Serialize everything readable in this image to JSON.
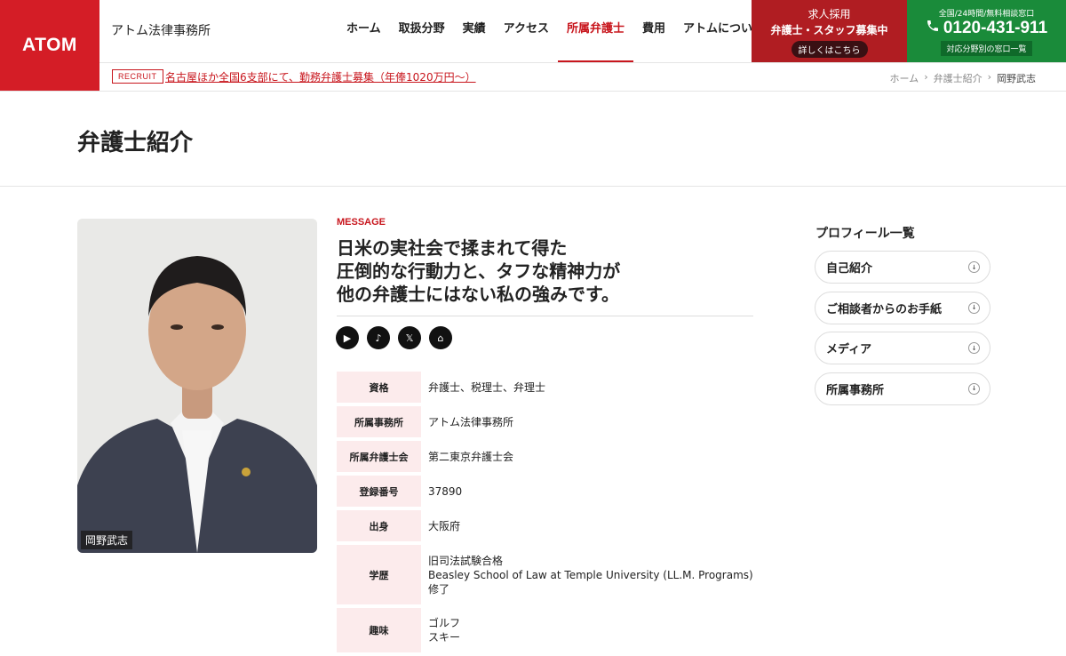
{
  "header": {
    "logo": "ATOM",
    "firm_name": "アトム法律事務所",
    "nav": [
      {
        "label": "ホーム"
      },
      {
        "label": "取扱分野"
      },
      {
        "label": "実績"
      },
      {
        "label": "アクセス"
      },
      {
        "label": "所属弁護士"
      },
      {
        "label": "費用"
      },
      {
        "label": "アトムについて"
      }
    ],
    "recruit_box": {
      "line1": "求人採用",
      "line2": "弁護士・スタッフ募集中",
      "button": "詳しくはこちら"
    },
    "phone_box": {
      "line1": "全国/24時間/無料相談窓口",
      "number": "0120-431-911",
      "sub": "対応分野別の窓口一覧"
    },
    "subbar": {
      "tag": "RECRUIT",
      "link": "名古屋ほか全国6支部にて、勤務弁護士募集（年俸1020万円〜）"
    },
    "breadcrumb": [
      "ホーム",
      "弁護士紹介",
      "岡野武志"
    ],
    "breadcrumb_sep": "›"
  },
  "page_title": "弁護士紹介",
  "portrait": {
    "name": "岡野武志"
  },
  "message": {
    "label": "MESSAGE",
    "lines": [
      "日米の実社会で揉まれて得た",
      "圧倒的な行動力と、タフな精神力が",
      "他の弁護士にはない私の強みです。"
    ]
  },
  "socials": [
    {
      "icon": "youtube-icon",
      "glyph": "▶"
    },
    {
      "icon": "tiktok-icon",
      "glyph": "♪"
    },
    {
      "icon": "x-icon",
      "glyph": "𝕏"
    },
    {
      "icon": "home-icon",
      "glyph": "⌂"
    }
  ],
  "profile": [
    {
      "key": "資格",
      "values": [
        "弁護士、税理士、弁理士"
      ]
    },
    {
      "key": "所属事務所",
      "values": [
        "アトム法律事務所"
      ]
    },
    {
      "key": "所属弁護士会",
      "values": [
        "第二東京弁護士会"
      ]
    },
    {
      "key": "登録番号",
      "values": [
        "37890"
      ]
    },
    {
      "key": "出身",
      "values": [
        "大阪府"
      ]
    },
    {
      "key": "学歴",
      "values": [
        "旧司法試験合格",
        "Beasley School of Law at Temple University (LL.M. Programs)",
        "修了"
      ]
    },
    {
      "key": "趣味",
      "values": [
        "ゴルフ",
        "スキー"
      ]
    }
  ],
  "sidebar": {
    "title": "プロフィール一覧",
    "items": [
      {
        "label": "自己紹介"
      },
      {
        "label": "ご相談者からのお手紙"
      },
      {
        "label": "メディア"
      },
      {
        "label": "所属事務所"
      }
    ]
  },
  "colors": {
    "brand_red": "#d41d26",
    "recruit_red": "#b01d22",
    "phone_green": "#1a8b3a",
    "key_bg": "#fcebec"
  }
}
